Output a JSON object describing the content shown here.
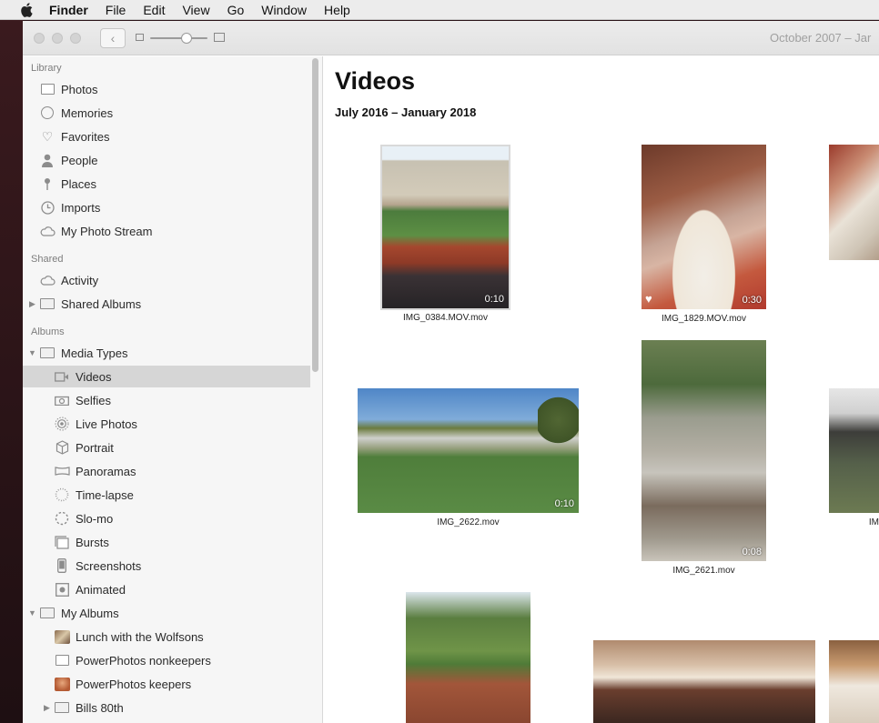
{
  "menubar": {
    "items": [
      "Finder",
      "File",
      "Edit",
      "View",
      "Go",
      "Window",
      "Help"
    ]
  },
  "toolbar": {
    "date_range": "October 2007 – Jar"
  },
  "sidebar": {
    "sections": {
      "library": "Library",
      "shared": "Shared",
      "albums": "Albums"
    },
    "library": [
      "Photos",
      "Memories",
      "Favorites",
      "People",
      "Places",
      "Imports",
      "My Photo Stream"
    ],
    "shared": [
      "Activity",
      "Shared Albums"
    ],
    "media_types": "Media Types",
    "media": [
      "Videos",
      "Selfies",
      "Live Photos",
      "Portrait",
      "Panoramas",
      "Time-lapse",
      "Slo-mo",
      "Bursts",
      "Screenshots",
      "Animated"
    ],
    "my_albums": "My Albums",
    "albums": [
      "Lunch with the Wolfsons",
      "PowerPhotos nonkeepers",
      "PowerPhotos keepers",
      "Bills 80th"
    ],
    "selected": "Videos"
  },
  "main": {
    "title": "Videos",
    "subtitle": "July 2016 – January 2018",
    "videos": [
      {
        "name": "IMG_0384.MOV.mov",
        "duration": "0:10",
        "favorite": false
      },
      {
        "name": "IMG_1829.MOV.mov",
        "duration": "0:30",
        "favorite": true
      },
      {
        "name": "",
        "duration": "",
        "favorite": false
      },
      {
        "name": "IMG_2622.mov",
        "duration": "0:10",
        "favorite": false
      },
      {
        "name": "IMG_2621.mov",
        "duration": "0:08",
        "favorite": false
      },
      {
        "name": "IM",
        "duration": "",
        "favorite": false
      }
    ]
  },
  "colors": {
    "selection": "#d6d6d6",
    "sidebar_bg": "#f6f6f6"
  }
}
